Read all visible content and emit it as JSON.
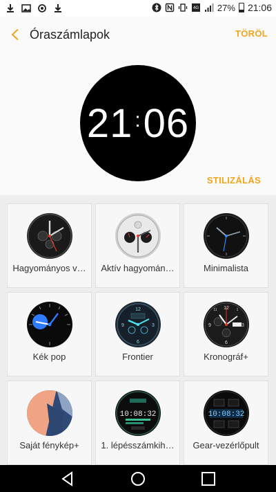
{
  "status_bar": {
    "battery_percent": "27%",
    "time": "21:06",
    "left_icons": [
      "download-icon",
      "image-icon",
      "sync-icon",
      "download-icon"
    ],
    "right_icons": [
      "bluetooth-icon",
      "nfc-icon",
      "vibrate-icon",
      "mobile-data-icon",
      "signal-icon",
      "battery-icon"
    ]
  },
  "header": {
    "title": "Óraszámlapok",
    "delete_label": "TÖRÖL",
    "preview_hours": "21",
    "preview_colon": ":",
    "preview_minutes": "06",
    "style_label": "STILIZÁLÁS",
    "accent_color": "#f2a51a"
  },
  "watch_faces": [
    {
      "label": "Hagyományos v…",
      "icon": "traditional-watch-icon"
    },
    {
      "label": "Aktív hagyomán…",
      "icon": "active-traditional-watch-icon"
    },
    {
      "label": "Minimalista",
      "icon": "minimalist-watch-icon"
    },
    {
      "label": "Kék pop",
      "icon": "blue-pop-watch-icon"
    },
    {
      "label": "Frontier",
      "icon": "frontier-watch-icon"
    },
    {
      "label": "Kronográf+",
      "icon": "chronograph-watch-icon"
    },
    {
      "label": "Saját fénykép+",
      "icon": "own-photo-watch-icon"
    },
    {
      "label": "1. lépésszámkih…",
      "icon": "step-counter-watch-icon",
      "thumb_time": "10:08:32"
    },
    {
      "label": "Gear-vezérlőpult",
      "icon": "gear-dashboard-watch-icon",
      "thumb_time": "10:08:32"
    }
  ],
  "nav_bar": {
    "buttons": [
      "back-nav-icon",
      "home-nav-icon",
      "recents-nav-icon"
    ]
  }
}
